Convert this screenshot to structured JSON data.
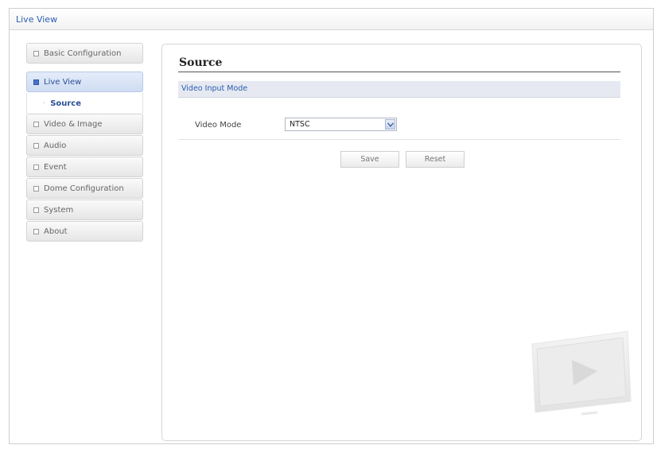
{
  "window": {
    "title": "Live View"
  },
  "sidebar": {
    "items": [
      {
        "label": "Basic Configuration"
      },
      {
        "label": "Live View"
      },
      {
        "label": "Video & Image"
      },
      {
        "label": "Audio"
      },
      {
        "label": "Event"
      },
      {
        "label": "Dome Configuration"
      },
      {
        "label": "System"
      },
      {
        "label": "About"
      }
    ],
    "sub_items": [
      {
        "label": "Source"
      }
    ]
  },
  "main": {
    "title": "Source",
    "section": "Video Input Mode",
    "video_mode": {
      "label": "Video Mode",
      "value": "NTSC"
    },
    "buttons": {
      "save": "Save",
      "reset": "Reset"
    }
  },
  "colors": {
    "accent": "#2a5db0",
    "section_bg": "#e6e9f1"
  }
}
